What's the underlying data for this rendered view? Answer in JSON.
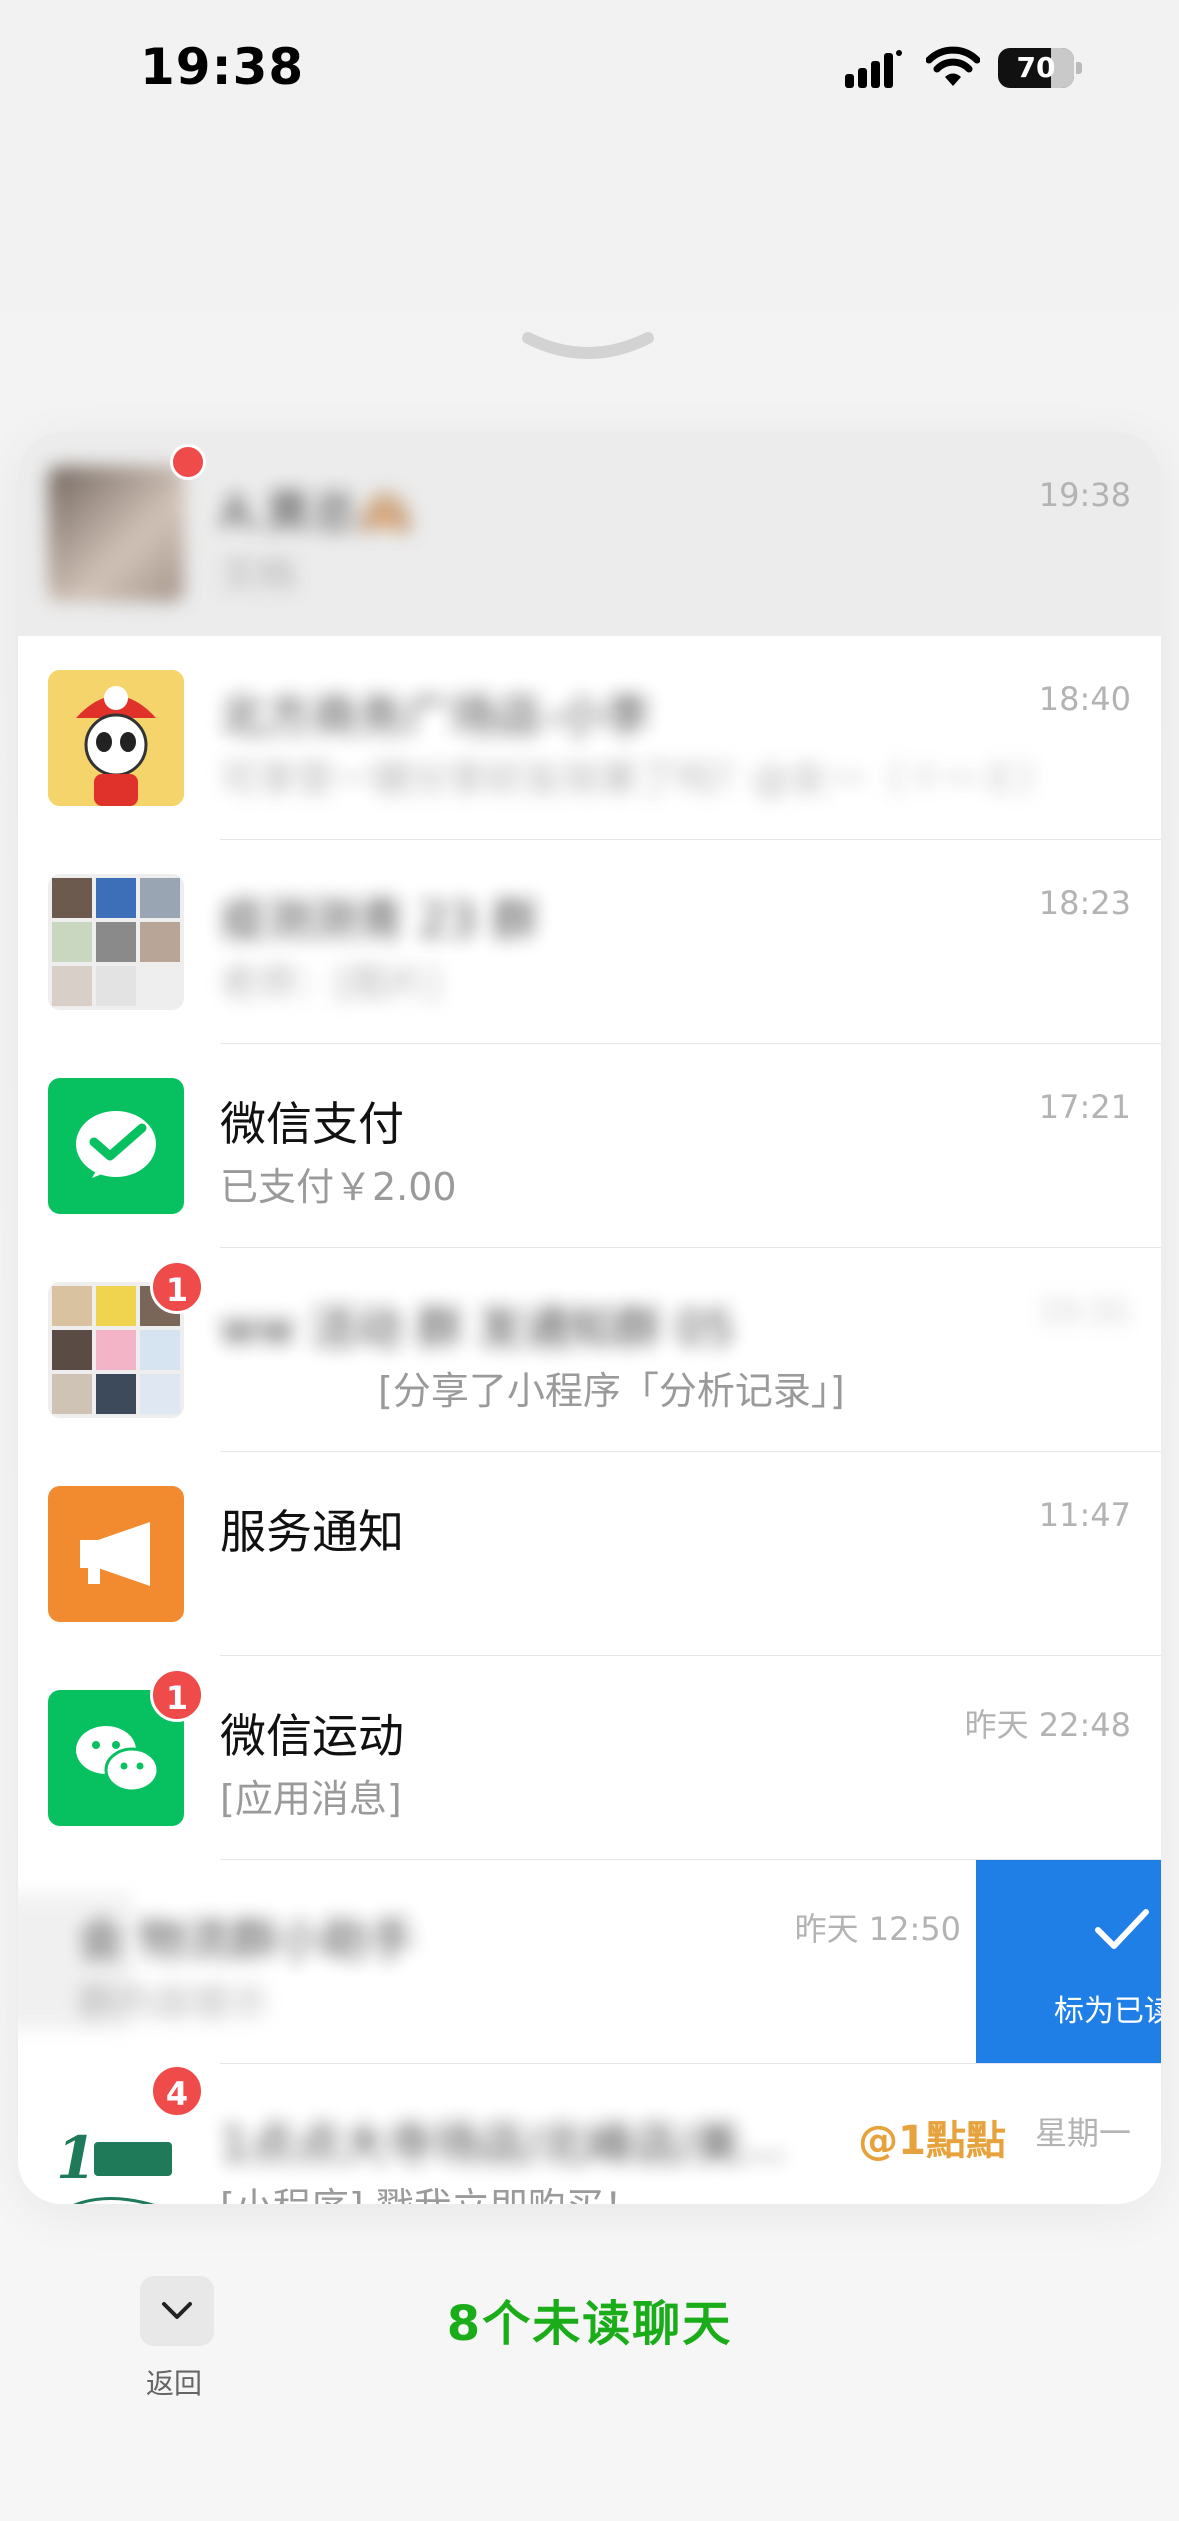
{
  "status": {
    "time": "19:38",
    "battery": "70",
    "battery_level": 0.7
  },
  "chats": [
    {
      "name": "A.黄总🙈",
      "preview": "文档",
      "time": "19:38",
      "badge": "",
      "blurred": true,
      "highlighted": true
    },
    {
      "name": "北方商务广场店-小李",
      "preview": "可享受一键分享好友效果了吗？@女一（ヾ一ミ）",
      "time": "18:40",
      "badge": "",
      "blurred": true,
      "highlighted": false
    },
    {
      "name": "疫测测青 23 群",
      "preview": "老师：[图片]",
      "time": "18:23",
      "badge": "",
      "blurred": true,
      "highlighted": false
    },
    {
      "name": "微信支付",
      "preview": "已支付￥2.00",
      "time": "17:21",
      "badge": "",
      "blurred": false,
      "highlighted": false
    },
    {
      "name": "ww 活动 群 发通知群 05",
      "preview": "[分享了小程序「分析记录」]",
      "time": "15:31",
      "badge": "1",
      "blurred": true,
      "highlighted": false
    },
    {
      "name": "服务通知",
      "preview": "",
      "time": "11:47",
      "badge": "",
      "blurred": false,
      "highlighted": false
    },
    {
      "name": "微信运动",
      "preview": "[应用消息]",
      "time": "昨天 22:48",
      "badge": "1",
      "blurred": false,
      "highlighted": false
    },
    {
      "name": "会 物流群小助手",
      "preview": "群内容提示",
      "time": "昨天 12:50",
      "badge": "",
      "blurred": true,
      "highlighted": false
    },
    {
      "name": "1点点大寺场店/北峰店/美…",
      "preview": "[小程序] 戳我立即购买！",
      "time": "星期一",
      "badge": "4",
      "blurred": true,
      "highlighted": false,
      "mention": "@1點點"
    }
  ],
  "swipe_action": {
    "label": "标为已读"
  },
  "footer": {
    "back_label": "返回",
    "unread_title": "8个未读聊天"
  },
  "colors": {
    "wechat_green": "#07c160",
    "badge_red": "#f04b4b",
    "swipe_blue": "#1f7fe6",
    "accent_green": "#1aad19"
  }
}
